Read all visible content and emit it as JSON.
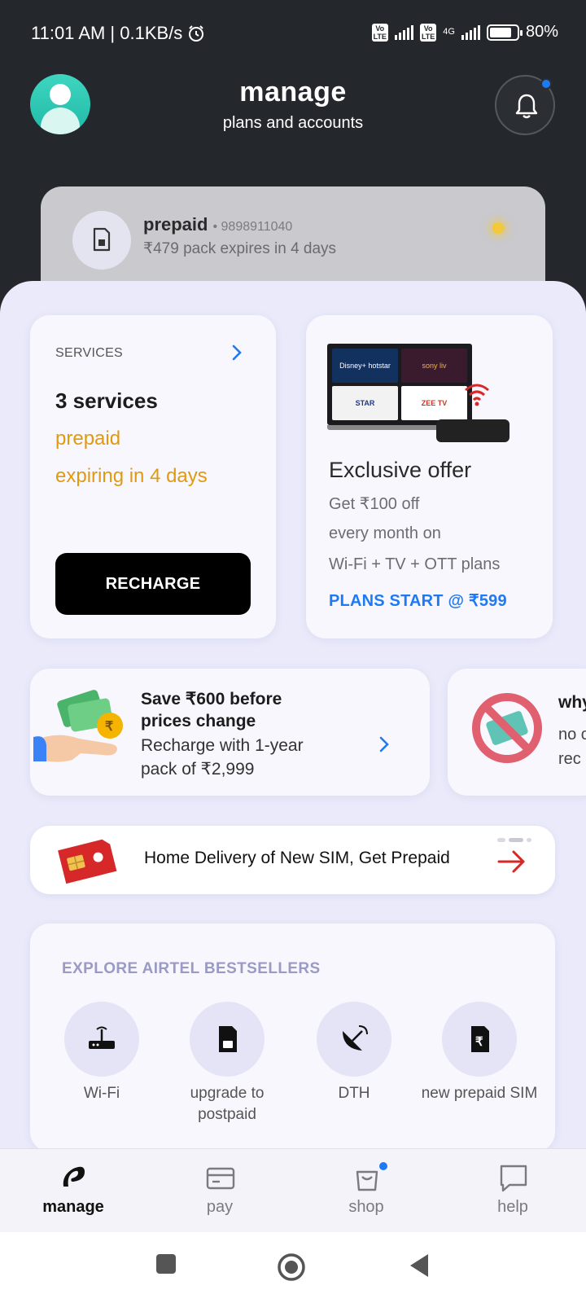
{
  "status_bar": {
    "time_speed": "11:01 AM | 0.1KB/s",
    "volte_label": "Vo LTE",
    "network": "4G",
    "battery": "80%",
    "battery_level": 0.8
  },
  "header": {
    "title": "manage",
    "subtitle": "plans and accounts"
  },
  "prepaid_card": {
    "title": "prepaid",
    "number": "• 9898911040",
    "subtitle": "₹479 pack expires in 4 days"
  },
  "services_card": {
    "heading": "SERVICES",
    "count": "3 services",
    "type": "prepaid",
    "expiry": "expiring in 4 days",
    "button": "RECHARGE"
  },
  "offer_card": {
    "tv_tiles": [
      "Disney+ hotstar",
      "sony liv",
      "STAR",
      "ZEE TV"
    ],
    "title": "Exclusive offer",
    "line1": "Get ₹100 off",
    "line2": "every month on",
    "line3": "Wi-Fi + TV + OTT plans",
    "cta": "PLANS START @ ₹599"
  },
  "save_card": {
    "title_line1": "Save ₹600 before",
    "title_line2": "prices change",
    "sub_line1": "Recharge with 1-year",
    "sub_line2": "pack of ₹2,999"
  },
  "why_card": {
    "title": "why",
    "line1": "no c",
    "line2": "rec"
  },
  "sim_banner": {
    "text": "Home Delivery of New SIM, Get Prepaid"
  },
  "explore": {
    "title": "EXPLORE AIRTEL BESTSELLERS",
    "items": [
      {
        "icon": "router-icon",
        "label": "Wi-Fi"
      },
      {
        "icon": "sim-card-icon",
        "label": "upgrade to postpaid"
      },
      {
        "icon": "satellite-dish-icon",
        "label": "DTH"
      },
      {
        "icon": "rupee-sim-icon",
        "label": "new prepaid SIM"
      }
    ]
  },
  "bottom_nav": {
    "items": [
      {
        "label": "manage",
        "icon": "airtel-logo-icon",
        "active": true
      },
      {
        "label": "pay",
        "icon": "card-icon",
        "active": false
      },
      {
        "label": "shop",
        "icon": "bag-icon",
        "active": false
      },
      {
        "label": "help",
        "icon": "chat-icon",
        "active": false
      }
    ]
  },
  "colors": {
    "accent": "#1f7af2",
    "warning": "#e09a12",
    "dark_bg": "#24272c",
    "panel_bg": "#eaeafb"
  }
}
